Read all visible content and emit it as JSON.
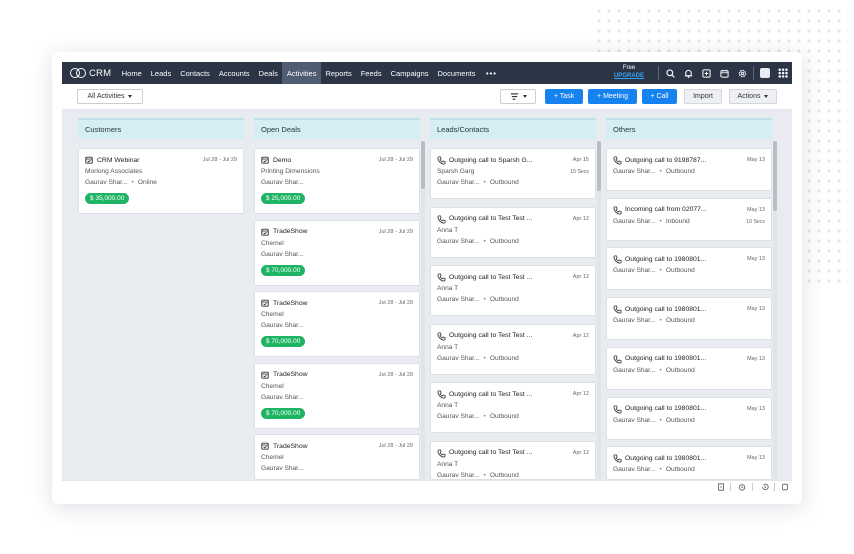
{
  "nav": {
    "logo_text": "CRM",
    "items": [
      "Home",
      "Leads",
      "Contacts",
      "Accounts",
      "Deals",
      "Activities",
      "Reports",
      "Feeds",
      "Campaigns",
      "Documents"
    ],
    "active": "Activities",
    "more": "•••",
    "plan": "Free",
    "upgrade": "UPGRADE",
    "icons": [
      "search-icon",
      "bell-icon",
      "add-record-icon",
      "calendar-icon",
      "settings-icon",
      "avatar",
      "apps-grid-icon"
    ]
  },
  "toolbar": {
    "filter_label": "All Activities",
    "view_icon": "kanban-view-icon",
    "task_label": "+ Task",
    "meeting_label": "+ Meeting",
    "call_label": "+ Call",
    "import_label": "Import",
    "actions_label": "Actions"
  },
  "columns": [
    {
      "title": "Customers",
      "cards": [
        {
          "icon": "calendar-check-icon",
          "title": "CRM Webinar",
          "date": "Jul 28 - Jul 29",
          "line1": "Morlong Associates",
          "owner": "Gaurav Shar...",
          "meta": "Online",
          "amount": "$ 35,000.00"
        }
      ]
    },
    {
      "title": "Open Deals",
      "cards": [
        {
          "icon": "calendar-check-icon",
          "title": "Demo",
          "date": "Jul 28 - Jul 29",
          "line1": "Printing Dimensions",
          "owner": "Gaurav Shar...",
          "amount": "$ 25,000.00"
        },
        {
          "icon": "calendar-check-icon",
          "title": "TradeShow",
          "date": "Jul 28 - Jul 29",
          "line1": "Chemel",
          "owner": "Gaurav Shar...",
          "amount": "$ 70,000.00"
        },
        {
          "icon": "calendar-check-icon",
          "title": "TradeShow",
          "date": "Jul 28 - Jul 29",
          "line1": "Chemel",
          "owner": "Gaurav Shar...",
          "amount": "$ 70,000.00"
        },
        {
          "icon": "calendar-check-icon",
          "title": "TradeShow",
          "date": "Jul 28 - Jul 29",
          "line1": "Chemel",
          "owner": "Gaurav Shar...",
          "amount": "$ 70,000.00"
        },
        {
          "icon": "calendar-check-icon",
          "title": "TradeShow",
          "date": "Jul 28 - Jul 29",
          "line1": "Chemel",
          "owner": "Gaurav Shar...",
          "amount": ""
        }
      ]
    },
    {
      "title": "Leads/Contacts",
      "cards": [
        {
          "icon": "phone-icon",
          "title": "Outgoing call to Sparsh G...",
          "date": "Apr 15",
          "duration": "15 Secs",
          "line1": "Sparsh Garg",
          "owner": "Gaurav Shar...",
          "meta": "Outbound"
        },
        {
          "icon": "phone-icon",
          "title": "Outgoing call to Test Test ...",
          "date": "Apr 12",
          "line1": "Anna T",
          "owner": "Gaurav Shar...",
          "meta": "Outbound"
        },
        {
          "icon": "phone-icon",
          "title": "Outgoing call to Test Test ...",
          "date": "Apr 12",
          "line1": "Anna T",
          "owner": "Gaurav Shar...",
          "meta": "Outbound"
        },
        {
          "icon": "phone-icon",
          "title": "Outgoing call to Test Test ...",
          "date": "Apr 12",
          "line1": "Anna T",
          "owner": "Gaurav Shar...",
          "meta": "Outbound"
        },
        {
          "icon": "phone-icon",
          "title": "Outgoing call to Test Test ...",
          "date": "Apr 12",
          "line1": "Anna T",
          "owner": "Gaurav Shar...",
          "meta": "Outbound"
        },
        {
          "icon": "phone-icon",
          "title": "Outgoing call to Test Test ...",
          "date": "Apr 12",
          "line1": "Anna T",
          "owner": "Gaurav Shar...",
          "meta": "Outbound"
        }
      ]
    },
    {
      "title": "Others",
      "cards": [
        {
          "icon": "phone-icon",
          "title": "Outgoing call to 9198787...",
          "date": "May 13",
          "owner": "Gaurav Shar...",
          "meta": "Outbound"
        },
        {
          "icon": "phone-icon",
          "title": "Incoming call from 02077...",
          "date": "May 13",
          "duration": "10 Secs",
          "owner": "Gaurav Shar...",
          "meta": "Inbound"
        },
        {
          "icon": "phone-icon",
          "title": "Outgoing call to 1980801...",
          "date": "May 13",
          "owner": "Gaurav Shar...",
          "meta": "Outbound"
        },
        {
          "icon": "phone-icon",
          "title": "Outgoing call to 1980801...",
          "date": "May 13",
          "owner": "Gaurav Shar...",
          "meta": "Outbound"
        },
        {
          "icon": "phone-icon",
          "title": "Outgoing call to 1980801...",
          "date": "May 13",
          "owner": "Gaurav Shar...",
          "meta": "Outbound"
        },
        {
          "icon": "phone-icon",
          "title": "Outgoing call to 1980801...",
          "date": "May 13",
          "owner": "Gaurav Shar...",
          "meta": "Outbound"
        },
        {
          "icon": "phone-icon",
          "title": "Outgoing call to 1980801...",
          "date": "May 13",
          "owner": "Gaurav Shar...",
          "meta": "Outbound"
        }
      ]
    }
  ],
  "statusbar": {
    "icons": [
      "sales-signals-icon",
      "alarm-icon",
      "history-icon",
      "notes-icon"
    ]
  }
}
